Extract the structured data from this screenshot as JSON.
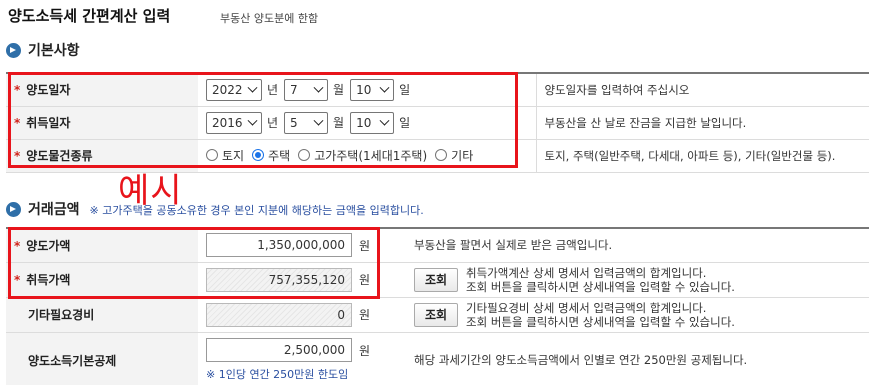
{
  "title": "양도소득세 간편계산 입력",
  "subtitle": "부동산 양도분에 한함",
  "section1": {
    "heading": "기본사항",
    "rows": {
      "transfer_date": {
        "label": "양도일자",
        "year": "2022",
        "month": "7",
        "day": "10",
        "desc": "양도일자를 입력하여 주십시오"
      },
      "acquire_date": {
        "label": "취득일자",
        "year": "2016",
        "month": "5",
        "day": "10",
        "desc": "부동산을 산 날로 잔금을 지급한 날입니다."
      },
      "property_type": {
        "label": "양도물건종류",
        "options": [
          "토지",
          "주택",
          "고가주택(1세대1주택)",
          "기타"
        ],
        "selected": "주택",
        "desc": "토지, 주택(일반주택, 다세대, 아파트 등), 기타(일반건물 등)."
      }
    },
    "units": {
      "year": "년",
      "month": "월",
      "day": "일"
    }
  },
  "annotation": "예시",
  "section2": {
    "heading": "거래금액",
    "note": "※ 고가주택을 공동소유한 경우 본인 지분에 해당하는 금액을 입력합니다.",
    "won": "원",
    "lookup_button": "조회",
    "rows": {
      "transfer_price": {
        "label": "양도가액",
        "value": "1,350,000,000",
        "desc": "부동산을 팔면서 실제로 받은 금액입니다."
      },
      "acquire_price": {
        "label": "취득가액",
        "value": "757,355,120",
        "desc1": "취득가액계산 상세 명세서 입력금액의 합계입니다.",
        "desc2": "조회 버튼을 클릭하시면 상세내역을 입력할 수 있습니다."
      },
      "other_expense": {
        "label": "기타필요경비",
        "value": "0",
        "desc1": "기타필요경비 상세 명세서 입력금액의 합계입니다.",
        "desc2": "조회 버튼을 클릭하시면 상세내역을 입력할 수 있습니다."
      },
      "basic_deduction": {
        "label": "양도소득기본공제",
        "value": "2,500,000",
        "hint": "※ 1인당 연간 250만원 한도임",
        "desc": "해당 과세기간의 양도소득금액에서 인별로 연간 250만원 공제됩니다."
      }
    }
  },
  "colors": {
    "required_star": "#d0241c",
    "highlight_box": "#e8141b",
    "section_bullet": "#2f6fa8",
    "note_text": "#2a4fa0",
    "radio_selected": "#1a73e8"
  }
}
